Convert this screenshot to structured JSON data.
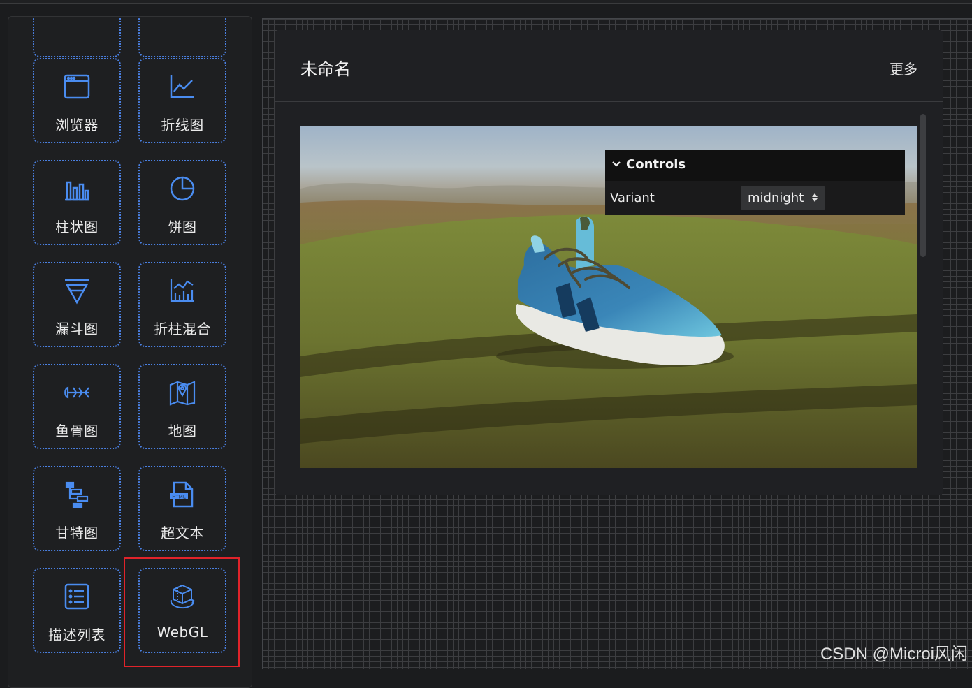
{
  "sidebar": {
    "items": [
      {
        "label": "浏览器",
        "icon": "browser-icon"
      },
      {
        "label": "折线图",
        "icon": "line-chart-icon"
      },
      {
        "label": "柱状图",
        "icon": "bar-chart-icon"
      },
      {
        "label": "饼图",
        "icon": "pie-chart-icon"
      },
      {
        "label": "漏斗图",
        "icon": "funnel-chart-icon"
      },
      {
        "label": "折柱混合",
        "icon": "line-bar-mix-icon"
      },
      {
        "label": "鱼骨图",
        "icon": "fishbone-icon"
      },
      {
        "label": "地图",
        "icon": "map-icon"
      },
      {
        "label": "甘特图",
        "icon": "gantt-icon"
      },
      {
        "label": "超文本",
        "icon": "html-file-icon"
      },
      {
        "label": "描述列表",
        "icon": "description-list-icon"
      },
      {
        "label": "WebGL",
        "icon": "webgl-cube-icon"
      }
    ],
    "accent": "#4a7fe0",
    "highlight_color": "#e0232a"
  },
  "card": {
    "title": "未命名",
    "more_label": "更多"
  },
  "controls": {
    "header": "Controls",
    "variant_label": "Variant",
    "variant_value": "midnight"
  },
  "watermark": "CSDN @Microi风闲"
}
